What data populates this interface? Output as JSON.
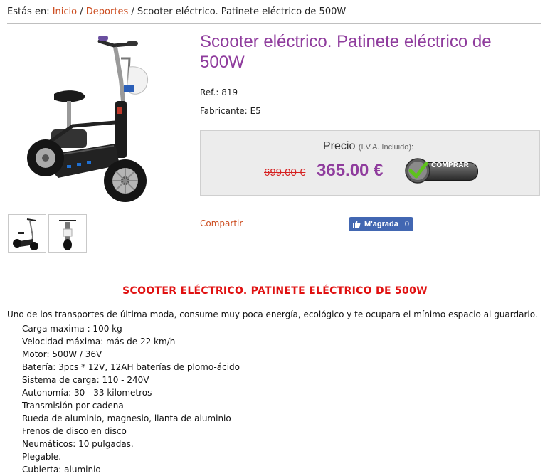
{
  "breadcrumb": {
    "prefix": "Estás en:",
    "home": "Inicio",
    "separator": "/",
    "category": "Deportes",
    "current": "Scooter eléctrico. Patinete eléctrico de 500W"
  },
  "product": {
    "title": "Scooter eléctrico. Patinete eléctrico de 500W",
    "ref_label": "Ref.:",
    "ref_value": "819",
    "manufacturer_label": "Fabricante:",
    "manufacturer_value": "E5"
  },
  "price": {
    "label": "Precio",
    "tax_note": "(I.V.A. Incluido):",
    "old_price": "699.00 €",
    "new_price": "365.00 €",
    "buy_label": "COMPRAR",
    "accent": "#8f3c9d",
    "strike_color": "#d62020"
  },
  "share": {
    "label": "Compartir",
    "fb_label": "M'agrada",
    "fb_count": "0"
  },
  "description": {
    "title": "SCOOTER ELÉCTRICO. PATINETE ELÉCTRICO DE 500W",
    "intro": "Uno de los transportes de última moda, consume muy poca energía, ecológico y te ocupara el mínimo espacio al guardarlo.",
    "specs": [
      "Carga maxima : 100 kg",
      "Velocidad máxima: más de 22 km/h",
      "Motor: 500W / 36V",
      "Batería: 3pcs * 12V, 12AH baterías de plomo-ácido",
      "Sistema de carga: 110 - 240V",
      "Autonomía: 30 - 33 kilometros",
      "Transmisión por cadena",
      "Rueda de aluminio, magnesio, llanta de aluminio",
      "Frenos de disco en disco",
      "Neumáticos: 10 pulgadas.",
      "Plegable.",
      "Cubierta: aluminio"
    ]
  }
}
